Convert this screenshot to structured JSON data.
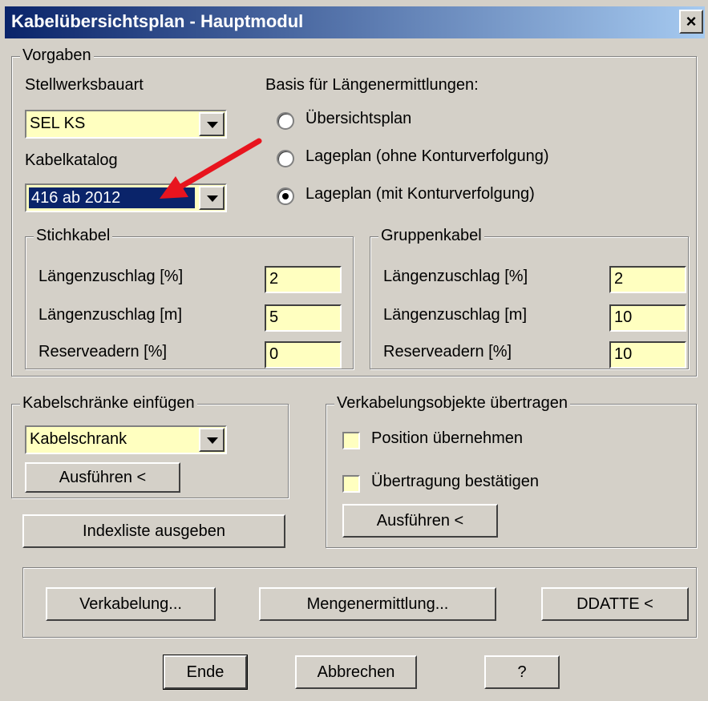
{
  "window": {
    "title": "Kabelübersichtsplan - Hauptmodul",
    "close_label": "×"
  },
  "vorgaben": {
    "legend": "Vorgaben",
    "stellwerksbauart_label": "Stellwerksbauart",
    "stellwerksbauart_value": "SEL KS",
    "kabelkatalog_label": "Kabelkatalog",
    "kabelkatalog_value": "416 ab 2012",
    "basis_label": "Basis für Längenermittlungen:",
    "radios": [
      {
        "label": "Übersichtsplan",
        "checked": false
      },
      {
        "label": "Lageplan (ohne Konturverfolgung)",
        "checked": false
      },
      {
        "label": "Lageplan (mit Konturverfolgung)",
        "checked": true
      }
    ],
    "stichkabel": {
      "legend": "Stichkabel",
      "rows": [
        {
          "label": "Längenzuschlag [%]",
          "value": "2"
        },
        {
          "label": "Längenzuschlag [m]",
          "value": "5"
        },
        {
          "label": "Reserveadern [%]",
          "value": "0"
        }
      ]
    },
    "gruppenkabel": {
      "legend": "Gruppenkabel",
      "rows": [
        {
          "label": "Längenzuschlag [%]",
          "value": "2"
        },
        {
          "label": "Längenzuschlag [m]",
          "value": "10"
        },
        {
          "label": "Reserveadern [%]",
          "value": "10"
        }
      ]
    }
  },
  "kabelschraenke": {
    "legend": "Kabelschränke einfügen",
    "combo_value": "Kabelschrank",
    "execute_label": "Ausführen <"
  },
  "indexliste_label": "Indexliste ausgeben",
  "verkabelungsobjekte": {
    "legend": "Verkabelungsobjekte übertragen",
    "checks": [
      {
        "label": "Position übernehmen",
        "checked": false
      },
      {
        "label": "Übertragung bestätigen",
        "checked": false
      }
    ],
    "execute_label": "Ausführen <"
  },
  "actions": {
    "verkabelung": "Verkabelung...",
    "mengenermittlung": "Mengenermittlung...",
    "ddatte": "DDATTE <"
  },
  "footer": {
    "ende": "Ende",
    "abbrechen": "Abbrechen",
    "help": "?"
  },
  "colors": {
    "title_start": "#0a246a",
    "title_end": "#a6caf0",
    "field_bg": "#ffffc0",
    "face": "#d4d0c8",
    "annotation_arrow": "#e8141e"
  }
}
